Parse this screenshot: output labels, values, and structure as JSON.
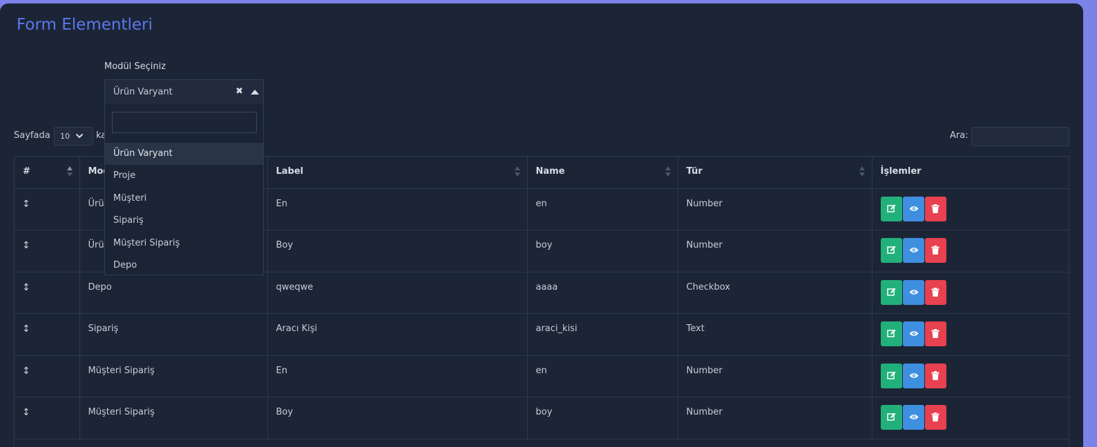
{
  "page": {
    "title": "Form Elementleri"
  },
  "module_select": {
    "label": "Modül Seçiniz",
    "value": "Ürün Varyant",
    "clear_glyph": "✖",
    "options": [
      "Ürün Varyant",
      "Proje",
      "Müşteri",
      "Sipariş",
      "Müşteri Sipariş",
      "Depo"
    ]
  },
  "table_controls": {
    "length_prefix": "Sayfada",
    "length_value": "10",
    "length_suffix": "ka",
    "search_label": "Ara:"
  },
  "table": {
    "headers": [
      "#",
      "Mod",
      "Label",
      "Name",
      "Tür",
      "İşlemler"
    ],
    "rows": [
      {
        "module": "Ürü",
        "label": "En",
        "name": "en",
        "type": "Number"
      },
      {
        "module": "Ürü",
        "label": "Boy",
        "name": "boy",
        "type": "Number"
      },
      {
        "module": "Depo",
        "label": "qweqwe",
        "name": "aaaa",
        "type": "Checkbox"
      },
      {
        "module": "Sipariş",
        "label": "Aracı Kişi",
        "name": "araci_kisi",
        "type": "Text"
      },
      {
        "module": "Müşteri Sipariş",
        "label": "En",
        "name": "en",
        "type": "Number"
      },
      {
        "module": "Müşteri Sipariş",
        "label": "Boy",
        "name": "boy",
        "type": "Number"
      }
    ]
  },
  "icons": {
    "drag": "vertical-arrows-icon",
    "edit": "edit-icon",
    "view": "eye-icon",
    "delete": "trash-icon"
  },
  "colors": {
    "title": "#5b78f0",
    "edit_button": "#22b07a",
    "view_button": "#3f8fe0",
    "delete_button": "#e8414f",
    "background": "#1c2536"
  }
}
